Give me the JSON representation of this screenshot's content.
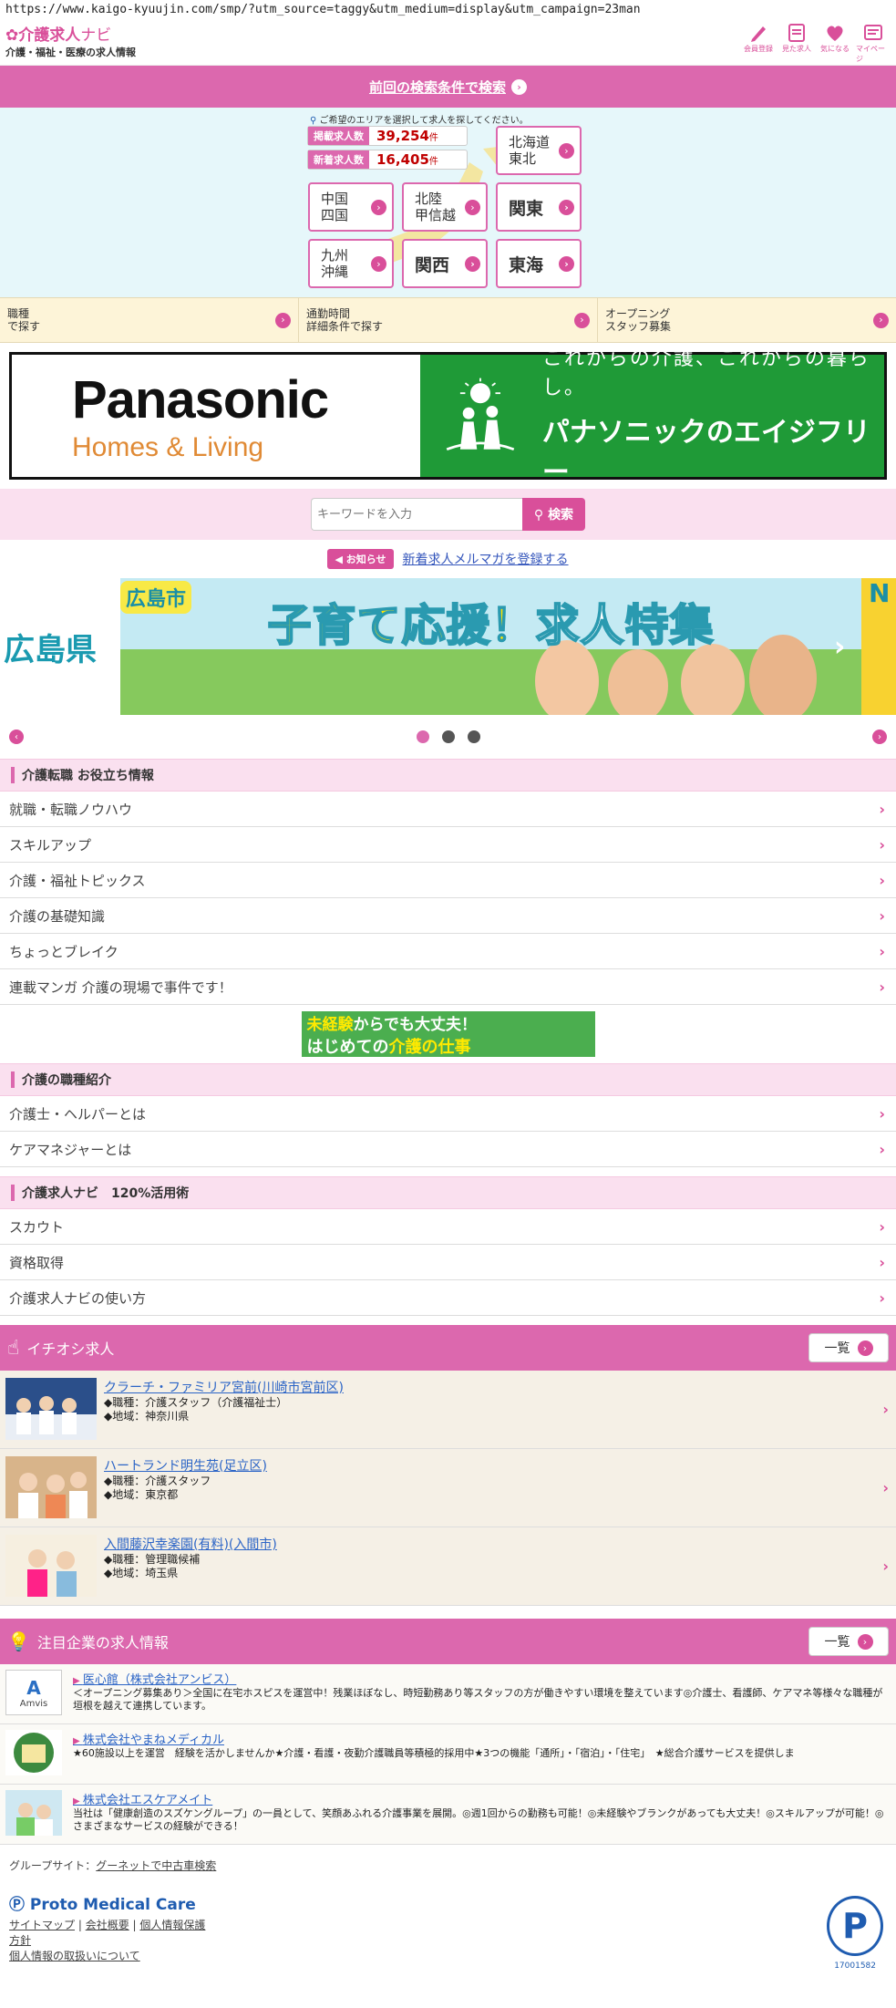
{
  "browser": {
    "url": "https://www.kaigo-kyuujin.com/smp/?utm_source=taggy&utm_medium=display&utm_campaign=23man"
  },
  "header": {
    "logo_main": "介護求人",
    "logo_nav": "ナビ",
    "logo_sub": "介護・福祉・医療の求人情報",
    "icons": [
      {
        "icon": "pencil-icon",
        "label": "会員登録"
      },
      {
        "icon": "calendar-icon",
        "label": "見た求人"
      },
      {
        "icon": "heart-icon",
        "label": "気になる"
      },
      {
        "icon": "mypage-icon",
        "label": "マイページ"
      }
    ]
  },
  "prev_search": "前回の検索条件で検索",
  "area": {
    "hint": "ご希望のエリアを選択して求人を探してください。",
    "stats": [
      {
        "label": "掲載求人数",
        "value": "39,254",
        "unit": "件"
      },
      {
        "label": "新着求人数",
        "value": "16,405",
        "unit": "件"
      }
    ],
    "regions": [
      "北海道\n東北",
      "中国\n四国",
      "北陸\n甲信越",
      "関東",
      "九州\n沖縄",
      "関西",
      "東海"
    ]
  },
  "categories": [
    "職種\nで探す",
    "通勤時間\n詳細条件で探す",
    "オープニング\nスタッフ募集"
  ],
  "ad": {
    "brand": "Panasonic",
    "brand_sub": "Homes & Living",
    "tagline": "これからの介護、これからの暮らし。",
    "name": "パナソニックのエイジフリー"
  },
  "keyword": {
    "placeholder": "キーワードを入力",
    "button": "検索"
  },
  "news": {
    "tag": "お知らせ",
    "link": "新着求人メルマガを登録する"
  },
  "banner": {
    "left": "広島県",
    "city": "広島市",
    "title_a": "子育て応援！",
    "title_b": "求人特集",
    "next": "N"
  },
  "useful": {
    "title": "介護転職 お役立ち情報",
    "items": [
      "就職・転職ノウハウ",
      "スキルアップ",
      "介護・福祉トピックス",
      "介護の基礎知識",
      "ちょっとブレイク",
      "連載マンガ 介護の現場で事件です！"
    ]
  },
  "miniad": {
    "a": "未経験",
    "b": "からでも大丈夫！",
    "c": "はじめての",
    "d": "介護の仕事"
  },
  "jobtypes": {
    "title": "介護の職種紹介",
    "items": [
      "介護士・ヘルパーとは",
      "ケアマネジャーとは"
    ]
  },
  "howto": {
    "title": "介護求人ナビ　120%活用術",
    "items": [
      "スカウト",
      "資格取得",
      "介護求人ナビの使い方"
    ]
  },
  "pickup": {
    "title": "イチオシ求人",
    "all": "一覧",
    "jobs": [
      {
        "name": "クラーチ・ファミリア宮前(川崎市宮前区)",
        "job": "◆職種：介護スタッフ（介護福祉士）",
        "loc": "◆地域：神奈川県"
      },
      {
        "name": "ハートランド明生苑(足立区)",
        "job": "◆職種：介護スタッフ",
        "loc": "◆地域：東京都"
      },
      {
        "name": "入間藤沢幸楽園(有料)(入間市)",
        "job": "◆職種：管理職候補",
        "loc": "◆地域：埼玉県"
      }
    ]
  },
  "companies": {
    "title": "注目企業の求人情報",
    "all": "一覧",
    "items": [
      {
        "name": "医心館（株式会社アンビス）",
        "logo": "Amvis",
        "desc": "＜オープニング募集あり＞全国に在宅ホスピスを運営中！残業ほぼなし、時短勤務あり等スタッフの方が働きやすい環境を整えています◎介護士、看護師、ケアマネ等様々な職種が垣根を越えて連携しています。"
      },
      {
        "name": "株式会社やまねメディカル",
        "logo": "",
        "desc": "★60施設以上を運営　経験を活かしませんか★介護・看護・夜勤介護職員等積極的採用中★3つの機能「通所」・「宿泊」・「住宅」　★総合介護サービスを提供しま"
      },
      {
        "name": "株式会社エスケアメイト",
        "logo": "",
        "desc": "当社は「健康創造のスズケングループ」の一員として、笑顔あふれる介護事業を展開。◎週1回からの勤務も可能！◎未経験やブランクがあっても大丈夫！◎スキルアップが可能！◎さまざまなサービスの経験ができる！"
      }
    ]
  },
  "footer": {
    "group_label": "グループサイト：",
    "group_link": "グーネットで中古車検索",
    "brand": "Proto Medical Care",
    "links": [
      "サイトマップ",
      "会社概要",
      "個人情報保護",
      "方針",
      "個人情報の取扱いについて"
    ],
    "privacy_no": "17001582",
    "privacy_mark": "P"
  },
  "colors": {
    "accent": "#dc68ae",
    "area_bg": "#e6f7fa",
    "cat_bg": "#fdf4d8",
    "ad_green": "#1f9a37"
  }
}
